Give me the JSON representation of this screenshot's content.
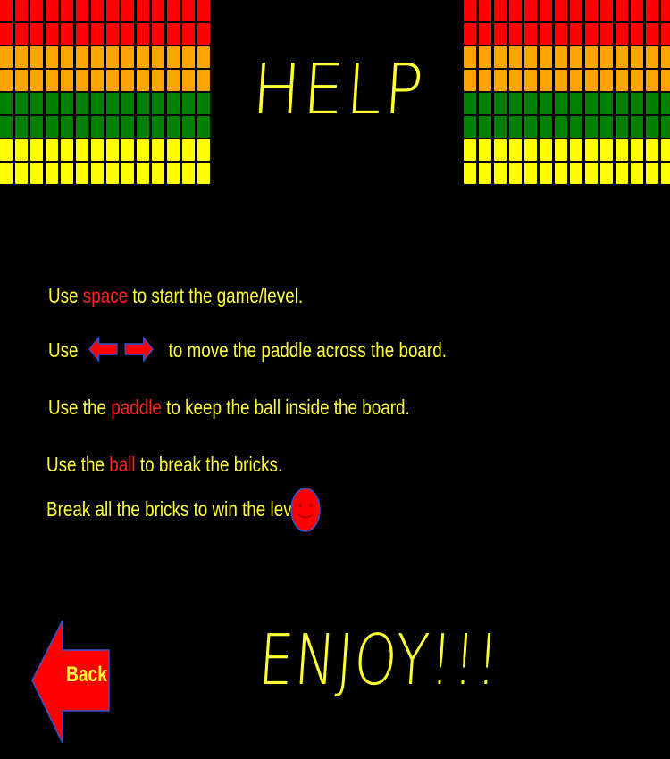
{
  "title": "HELP",
  "brick_colors": [
    "#ff0000",
    "#ff0000",
    "#ffa500",
    "#ffa500",
    "#008000",
    "#008000",
    "#ffff00",
    "#ffff00"
  ],
  "instructions": {
    "line1": {
      "pre": "Use ",
      "key": "space",
      "post": " to start the game/level."
    },
    "line2": {
      "pre": "Use",
      "post": "to move the paddle across the board."
    },
    "line3": {
      "pre": "Use the ",
      "key": "paddle",
      "post": " to keep the ball inside the board."
    },
    "line4": {
      "pre": "Use the ",
      "key": "ball",
      "post": " to break the bricks."
    },
    "line5": {
      "text": "Break all the bricks to win the level."
    }
  },
  "footer": {
    "enjoy": "ENJOY!!!"
  },
  "back_button": {
    "label": "Back"
  },
  "colors": {
    "text": "#ffff33",
    "highlight": "#ff2222",
    "arrow": "#ff0000",
    "arrow_border": "#3355cc"
  },
  "icons": [
    "left-arrow-icon",
    "right-arrow-icon",
    "smiley-icon",
    "back-arrow-icon"
  ]
}
